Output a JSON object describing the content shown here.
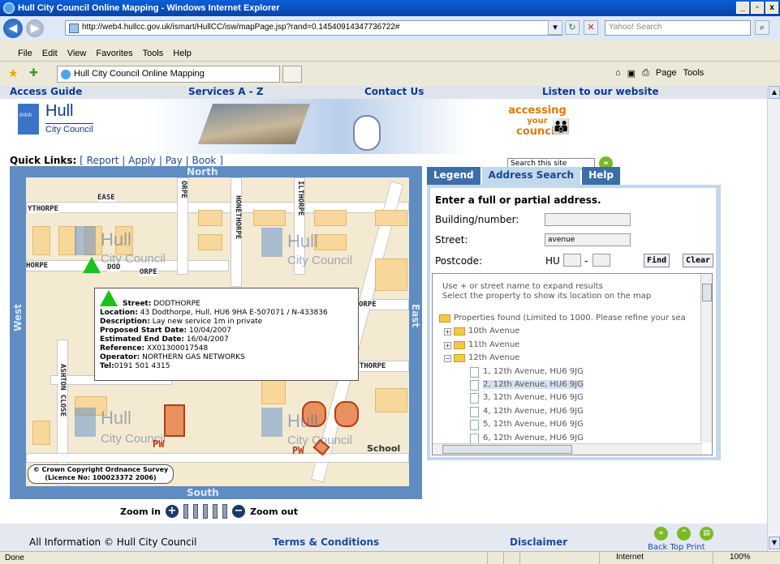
{
  "window": {
    "title": "Hull City Council Online Mapping - Windows Internet Explorer",
    "url": "http://web4.hullcc.gov.uk/ismart/HullCC/isw/mapPage.jsp?rand=0.14540914347736722#",
    "search_placeholder": "Yahoo! Search",
    "menu": [
      "File",
      "Edit",
      "View",
      "Favorites",
      "Tools",
      "Help"
    ],
    "tab_title": "Hull City Council Online Mapping",
    "toolbar_page": "Page",
    "toolbar_tools": "Tools",
    "status_done": "Done",
    "status_zone": "Internet",
    "status_zoom": "100%"
  },
  "topnav": {
    "access_guide": "Access Guide",
    "services": "Services A - Z",
    "contact": "Contact Us",
    "listen": "Listen to our website"
  },
  "header": {
    "logo_name": "Hull",
    "logo_sub": "City Council",
    "accessing": "accessing",
    "your": "your",
    "council": "council",
    "quick_links_label": "Quick Links:",
    "quick_links": [
      "Report",
      "Apply",
      "Pay",
      "Book"
    ],
    "site_search_value": "Search this site"
  },
  "map": {
    "north": "North",
    "south": "South",
    "east": "East",
    "west": "West",
    "road_labels": [
      "EASE",
      "YTHORPE",
      "ORPE",
      "HONETHORPE",
      "ILTHORPE",
      "HORPE",
      "DOD",
      "ORPE",
      "ORPE",
      "AXTHORPE",
      "ASHTON CLOSE"
    ],
    "watermark_top": "Hull",
    "watermark_sub": "City Council",
    "pw": "PW",
    "school": "School",
    "copyright_line1": "© Crown Copyright Ordnance Survey",
    "copyright_line2": "(Licence No: 100023372 2006)",
    "popup": {
      "street_label": "Street:",
      "street": "DODTHORPE",
      "location_label": "Location:",
      "location": "43 Dodthorpe, Hull. HU6 9HA E-507071 / N-433836",
      "description_label": "Description:",
      "description": "Lay new service 1m in private",
      "start_label": "Proposed Start Date:",
      "start": "10/04/2007",
      "end_label": "Estimated End Date:",
      "end": "16/04/2007",
      "reference_label": "Reference:",
      "reference": "XX01300017548",
      "operator_label": "Operator:",
      "operator": "NORTHERN GAS NETWORKS",
      "tel_label": "Tel:",
      "tel": "0191 501 4315"
    },
    "zoom_in": "Zoom in",
    "zoom_out": "Zoom out"
  },
  "panel": {
    "tabs": [
      "Legend",
      "Address Search",
      "Help"
    ],
    "heading": "Enter a full or partial address.",
    "building_label": "Building/number:",
    "building_value": "",
    "street_label": "Street:",
    "street_value": "avenue",
    "postcode_label": "Postcode:",
    "postcode_prefix": "HU",
    "postcode_dash": "-",
    "find": "Find",
    "clear": "Clear",
    "hint1": "Use + or street name to expand results",
    "hint2": "Select the property to show its location on the map",
    "found": "Properties found (Limited to 1000. Please refine your sea",
    "tree": [
      {
        "label": "10th Avenue",
        "type": "folder",
        "expanded": false
      },
      {
        "label": "11th Avenue",
        "type": "folder",
        "expanded": false
      },
      {
        "label": "12th Avenue",
        "type": "folder",
        "expanded": true
      },
      {
        "label": "1, 12th Avenue, HU6 9JG",
        "type": "doc",
        "selected": false
      },
      {
        "label": "2, 12th Avenue, HU6 9JG",
        "type": "doc",
        "selected": true
      },
      {
        "label": "3, 12th Avenue, HU6 9JG",
        "type": "doc",
        "selected": false
      },
      {
        "label": "4, 12th Avenue, HU6 9JG",
        "type": "doc",
        "selected": false
      },
      {
        "label": "5, 12th Avenue, HU6 9JG",
        "type": "doc",
        "selected": false
      },
      {
        "label": "6, 12th Avenue, HU6 9JG",
        "type": "doc",
        "selected": false
      }
    ]
  },
  "footer": {
    "all_info": "All Information © Hull City Council",
    "terms": "Terms & Conditions",
    "disclaimer": "Disclaimer",
    "back_top_print": "Back Top Print"
  }
}
